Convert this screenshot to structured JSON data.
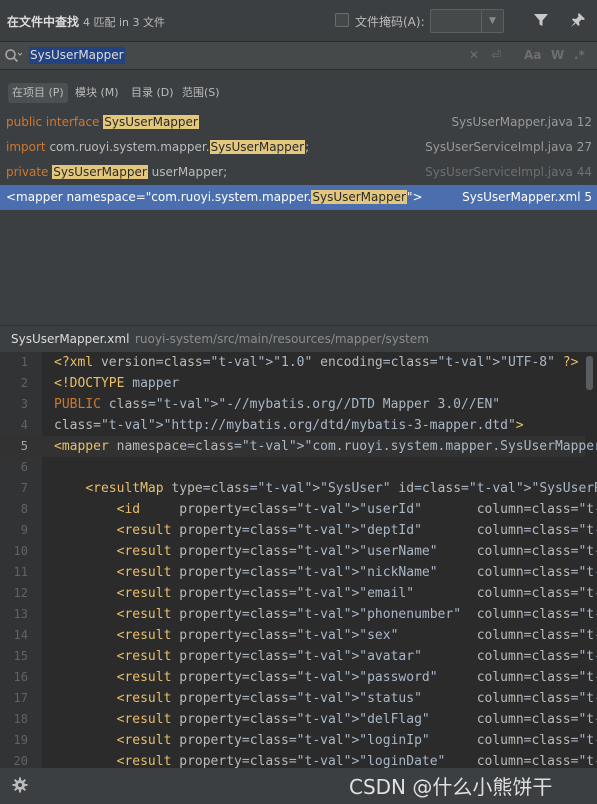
{
  "header": {
    "title": "在文件中查找",
    "count": "4 匹配 in 3 文件",
    "file_mask_label": "文件掩码(A):",
    "file_mask_value": ""
  },
  "search": {
    "query": "SysUserMapper",
    "buttons": [
      "Aa",
      "W",
      ".*"
    ]
  },
  "scopes": [
    {
      "label": "在项目 (P)",
      "selected": true
    },
    {
      "label": "模块 (M)",
      "selected": false
    },
    {
      "label": "目录 (D)",
      "selected": false
    },
    {
      "label": "范围(S)",
      "selected": false
    }
  ],
  "results": [
    {
      "prefix": "public interface ",
      "match": "SysUserMapper",
      "suffix": "",
      "file": "SysUserMapper.java 12"
    },
    {
      "prefix": "import com.ruoyi.system.mapper.",
      "match": "SysUserMapper",
      "suffix": ";",
      "file": "SysUserServiceImpl.java 27"
    },
    {
      "prefix": "private ",
      "match": "SysUserMapper",
      "suffix": " userMapper;",
      "file": "SysUserServiceImpl.java 44"
    },
    {
      "prefix": "<mapper namespace=\"com.ruoyi.system.mapper.",
      "match": "SysUserMapper",
      "suffix": "\">",
      "file": "SysUserMapper.xml 5"
    }
  ],
  "preview": {
    "file": "SysUserMapper.xml",
    "path": "ruoyi-system/src/main/resources/mapper/system"
  },
  "code_lines": [
    {
      "n": "1",
      "text": "<?xml version=\"1.0\" encoding=\"UTF-8\" ?>"
    },
    {
      "n": "2",
      "text": "<!DOCTYPE mapper"
    },
    {
      "n": "3",
      "text": "PUBLIC \"-//mybatis.org//DTD Mapper 3.0//EN\""
    },
    {
      "n": "4",
      "text": "\"http://mybatis.org/dtd/mybatis-3-mapper.dtd\">"
    },
    {
      "n": "5",
      "text": "<mapper namespace=\"com.ruoyi.system.mapper.SysUserMapper\">"
    },
    {
      "n": "6",
      "text": ""
    },
    {
      "n": "7",
      "text": "    <resultMap type=\"SysUser\" id=\"SysUserResult\">"
    },
    {
      "n": "8",
      "text": "        <id     property=\"userId\"       column=\"user_id\"      />"
    },
    {
      "n": "9",
      "text": "        <result property=\"deptId\"       column=\"dept_id\"      />"
    },
    {
      "n": "10",
      "text": "        <result property=\"userName\"     column=\"user_name\"    />"
    },
    {
      "n": "11",
      "text": "        <result property=\"nickName\"     column=\"nick_name\"    />"
    },
    {
      "n": "12",
      "text": "        <result property=\"email\"        column=\"email\"        />"
    },
    {
      "n": "13",
      "text": "        <result property=\"phonenumber\"  column=\"phonenumber\"  />"
    },
    {
      "n": "14",
      "text": "        <result property=\"sex\"          column=\"sex\"          />"
    },
    {
      "n": "15",
      "text": "        <result property=\"avatar\"       column=\"avatar\"       />"
    },
    {
      "n": "16",
      "text": "        <result property=\"password\"     column=\"password\"     />"
    },
    {
      "n": "17",
      "text": "        <result property=\"status\"       column=\"status\"       />"
    },
    {
      "n": "18",
      "text": "        <result property=\"delFlag\"      column=\"del_flag\"     />"
    },
    {
      "n": "19",
      "text": "        <result property=\"loginIp\"      column=\"login_ip\"     />"
    },
    {
      "n": "20",
      "text": "        <result property=\"loginDate\"    column=\"login_date\"   />"
    }
  ],
  "current_line": "5",
  "watermark": "CSDN @什么小熊饼干",
  "colors": {
    "selection": "#4b6eaf",
    "match_highlight": "#e3c77d",
    "keyword": "#cc7832",
    "xml_tag": "#e8bf6a",
    "xml_value": "#6a8759"
  },
  "icons": {
    "filter": "filter-icon",
    "pin": "pin-icon",
    "search": "search-icon",
    "settings": "gear-icon"
  }
}
